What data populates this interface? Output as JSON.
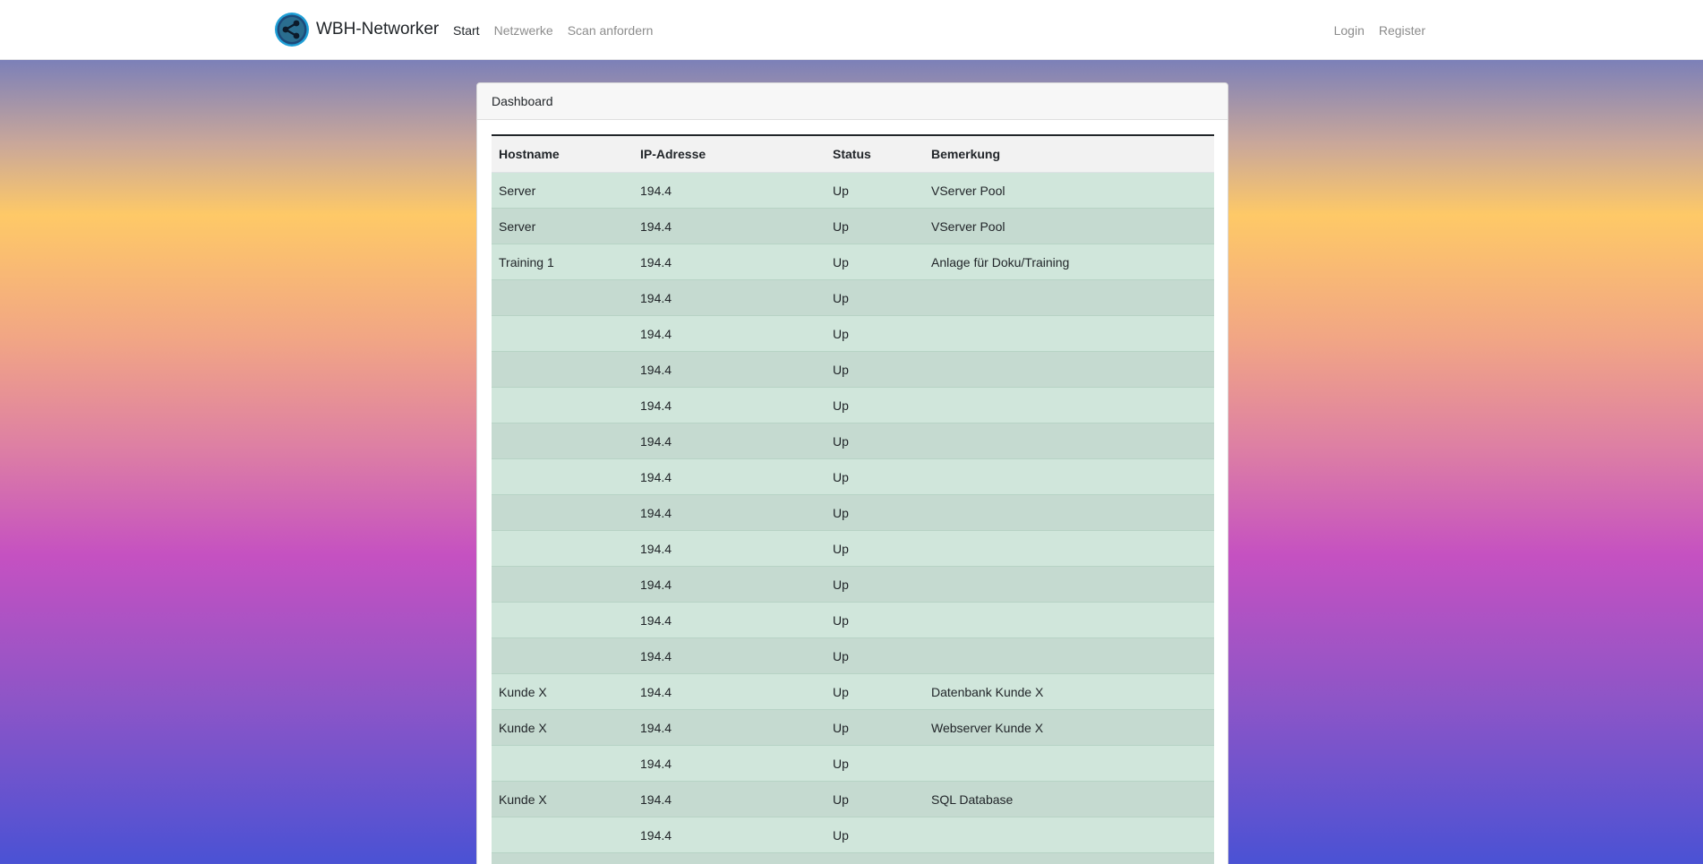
{
  "brand": {
    "name": "WBH-Networker",
    "logo_icon": "share-icon",
    "logo_colors": {
      "ring": "#1f9fd6",
      "fill": "#1d4a7a",
      "glyph": "#0c1a2a"
    }
  },
  "nav": {
    "left": [
      {
        "label": "Start",
        "active": true
      },
      {
        "label": "Netzwerke",
        "active": false
      },
      {
        "label": "Scan anfordern",
        "active": false
      }
    ],
    "right": [
      {
        "label": "Login"
      },
      {
        "label": "Register"
      }
    ]
  },
  "card": {
    "title": "Dashboard"
  },
  "table": {
    "columns": [
      "Hostname",
      "IP-Adresse",
      "Status",
      "Bemerkung"
    ],
    "rows": [
      {
        "hostname": "Server",
        "ip": "194.4",
        "status": "Up",
        "note": "VServer Pool"
      },
      {
        "hostname": "Server",
        "ip": "194.4",
        "status": "Up",
        "note": "VServer Pool"
      },
      {
        "hostname": "Training 1",
        "ip": "194.4",
        "status": "Up",
        "note": "Anlage für Doku/Training"
      },
      {
        "hostname": "",
        "ip": "194.4",
        "status": "Up",
        "note": ""
      },
      {
        "hostname": "",
        "ip": "194.4",
        "status": "Up",
        "note": ""
      },
      {
        "hostname": "",
        "ip": "194.4",
        "status": "Up",
        "note": ""
      },
      {
        "hostname": "",
        "ip": "194.4",
        "status": "Up",
        "note": ""
      },
      {
        "hostname": "",
        "ip": "194.4",
        "status": "Up",
        "note": ""
      },
      {
        "hostname": "",
        "ip": "194.4",
        "status": "Up",
        "note": ""
      },
      {
        "hostname": "",
        "ip": "194.4",
        "status": "Up",
        "note": ""
      },
      {
        "hostname": "",
        "ip": "194.4",
        "status": "Up",
        "note": ""
      },
      {
        "hostname": "",
        "ip": "194.4",
        "status": "Up",
        "note": ""
      },
      {
        "hostname": "",
        "ip": "194.4",
        "status": "Up",
        "note": ""
      },
      {
        "hostname": "",
        "ip": "194.4",
        "status": "Up",
        "note": ""
      },
      {
        "hostname": "Kunde X",
        "ip": "194.4",
        "status": "Up",
        "note": "Datenbank Kunde X"
      },
      {
        "hostname": "Kunde X",
        "ip": "194.4",
        "status": "Up",
        "note": "Webserver Kunde X"
      },
      {
        "hostname": "",
        "ip": "194.4",
        "status": "Up",
        "note": ""
      },
      {
        "hostname": "Kunde X",
        "ip": "194.4",
        "status": "Up",
        "note": "SQL Database"
      },
      {
        "hostname": "",
        "ip": "194.4",
        "status": "Up",
        "note": ""
      },
      {
        "hostname": "",
        "ip": "",
        "status": "",
        "note": ""
      }
    ]
  },
  "colors": {
    "row_odd": "#d0e6db",
    "row_even": "#c5dad0",
    "header_bg": "#f2f2f2",
    "nav_active": "#212529",
    "nav_inactive": "#8c8c8c"
  }
}
